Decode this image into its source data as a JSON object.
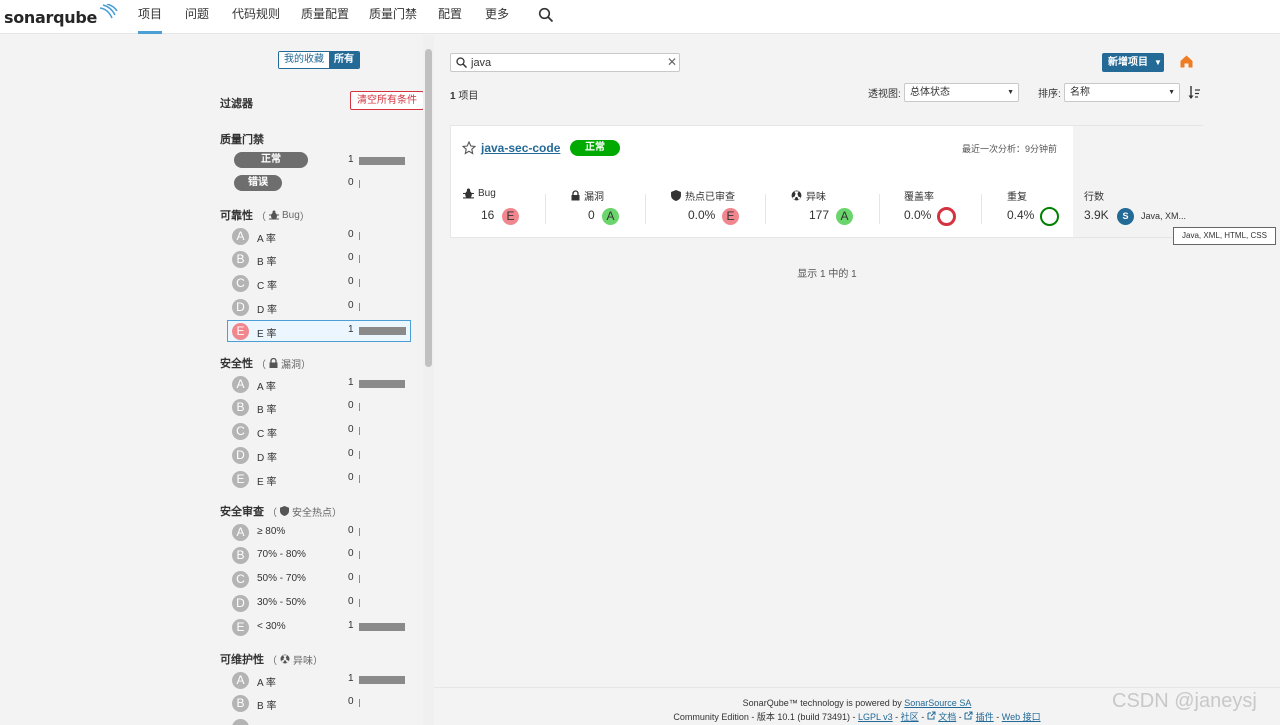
{
  "nav": {
    "logo": "sonarqube",
    "items": [
      "项目",
      "问题",
      "代码规则",
      "质量配置",
      "质量门禁",
      "配置",
      "更多"
    ],
    "active_index": 0
  },
  "sidebar": {
    "toggle": {
      "favorites": "我的收藏",
      "all": "所有",
      "selected": "all"
    },
    "filters_title": "过滤器",
    "clear_all": "清空所有条件",
    "quality_gate": {
      "title": "质量门禁",
      "items": [
        {
          "label": "正常",
          "count": "1",
          "fraction": 1.0
        },
        {
          "label": "错误",
          "count": "0",
          "fraction": 0.0
        }
      ]
    },
    "reliability": {
      "title": "可靠性",
      "open": "（",
      "sub": "Bug",
      "close": "）",
      "items": [
        {
          "grade": "A",
          "label": "A 率",
          "count": "0",
          "fraction": 0.0
        },
        {
          "grade": "B",
          "label": "B 率",
          "count": "0",
          "fraction": 0.0
        },
        {
          "grade": "C",
          "label": "C 率",
          "count": "0",
          "fraction": 0.0
        },
        {
          "grade": "D",
          "label": "D 率",
          "count": "0",
          "fraction": 0.0
        },
        {
          "grade": "E",
          "label": "E 率",
          "count": "1",
          "fraction": 1.0,
          "selected": true
        }
      ]
    },
    "security": {
      "title": "安全性",
      "open": "（",
      "sub": "漏洞",
      "close": "）",
      "items": [
        {
          "grade": "A",
          "label": "A 率",
          "count": "1",
          "fraction": 1.0
        },
        {
          "grade": "B",
          "label": "B 率",
          "count": "0",
          "fraction": 0.0
        },
        {
          "grade": "C",
          "label": "C 率",
          "count": "0",
          "fraction": 0.0
        },
        {
          "grade": "D",
          "label": "D 率",
          "count": "0",
          "fraction": 0.0
        },
        {
          "grade": "E",
          "label": "E 率",
          "count": "0",
          "fraction": 0.0
        }
      ]
    },
    "security_review": {
      "title": "安全审查",
      "open": "（",
      "sub": "安全热点",
      "close": "）",
      "items": [
        {
          "grade": "A",
          "label": "≥ 80%",
          "count": "0",
          "fraction": 0.0
        },
        {
          "grade": "B",
          "label": "70% - 80%",
          "count": "0",
          "fraction": 0.0
        },
        {
          "grade": "C",
          "label": "50% - 70%",
          "count": "0",
          "fraction": 0.0
        },
        {
          "grade": "D",
          "label": "30% - 50%",
          "count": "0",
          "fraction": 0.0
        },
        {
          "grade": "E",
          "label": "< 30%",
          "count": "1",
          "fraction": 1.0
        }
      ]
    },
    "maintainability": {
      "title": "可维护性",
      "open": "（",
      "sub": "异味",
      "close": "）",
      "items": [
        {
          "grade": "A",
          "label": "A 率",
          "count": "1",
          "fraction": 1.0
        },
        {
          "grade": "B",
          "label": "B 率",
          "count": "0",
          "fraction": 0.0
        }
      ]
    }
  },
  "main": {
    "search": {
      "value": "java",
      "clear": "✕"
    },
    "new_project": "新增项目",
    "project_count": "1",
    "project_count_suffix": " 项目",
    "perspective": {
      "label": "透视图:",
      "value": "总体状态"
    },
    "sort": {
      "label": "排序:",
      "value": "名称"
    },
    "project": {
      "name": "java-sec-code",
      "gate": "正常",
      "analysis": "最近一次分析：9分钟前",
      "bug": {
        "label": "Bug",
        "value": "16",
        "grade": "E"
      },
      "vulnerability": {
        "label": "漏洞",
        "value": "0",
        "grade": "A"
      },
      "hotspots": {
        "label": "热点已审查",
        "value": "0.0%",
        "grade": "E"
      },
      "smells": {
        "label": "异味",
        "value": "177",
        "grade": "A"
      },
      "coverage": {
        "label": "覆盖率",
        "value": "0.0%",
        "fraction": 0.0
      },
      "duplications": {
        "label": "重复",
        "value": "0.4%",
        "fraction": 0.004
      },
      "lines": {
        "label": "行数",
        "value": "3.9K",
        "size": "S",
        "languages": "Java, XM..."
      }
    },
    "tooltip": "Java, XML, HTML, CSS",
    "showing": "显示 1 中的 1"
  },
  "footer": {
    "powered_prefix": "SonarQube™ technology is powered by ",
    "powered_link": "SonarSource SA",
    "edition": "Community Edition - 版本 10.1 (build 73491) - ",
    "lgpl": "LGPL v3",
    "dash1": " - ",
    "community": "社区",
    "dash2": " - ",
    "docs": "文档",
    "dash3": " - ",
    "plugins": "插件",
    "dash4": " - ",
    "api": "Web 接口"
  },
  "watermark": "CSDN @janeysj",
  "colors": {
    "accent": "#236a97",
    "ok": "#00aa00",
    "grade_e": "#f0878e",
    "grade_a": "#6cd46c",
    "coverage_ring": "#d4333f",
    "dup_ring": "#008000"
  }
}
